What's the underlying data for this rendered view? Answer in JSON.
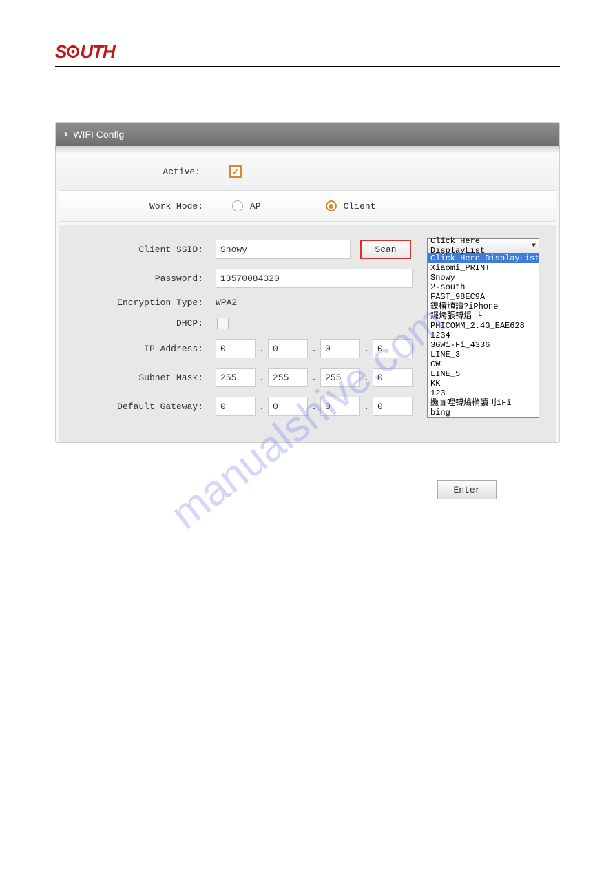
{
  "logo": {
    "s": "S",
    "u": "U",
    "t": "T",
    "h": "H"
  },
  "panel_title": "WIFI Config",
  "labels": {
    "active": "Active:",
    "work_mode": "Work Mode:",
    "client_ssid": "Client_SSID:",
    "password": "Password:",
    "encryption": "Encryption Type:",
    "dhcp": "DHCP:",
    "ip": "IP Address:",
    "subnet": "Subnet Mask:",
    "gateway": "Default Gateway:"
  },
  "work_mode": {
    "ap": "AP",
    "client": "Client"
  },
  "values": {
    "ssid": "Snowy",
    "password": "13570084320",
    "encryption": "WPA2",
    "ip": [
      "0",
      "0",
      "0",
      "0"
    ],
    "subnet": [
      "255",
      "255",
      "255",
      "0"
    ],
    "gateway": [
      "0",
      "0",
      "0",
      "0"
    ]
  },
  "buttons": {
    "scan": "Scan",
    "enter": "Enter"
  },
  "dropdown": {
    "selected": "Click Here DisplayList",
    "items": [
      "Click Here DisplayList",
      "Xiaomi_PRINT",
      "Snowy",
      "2-south",
      "FAST_98EC9A",
      "鎳椿頒讀?iPhone",
      "鑼烤張镈熖 └",
      "PHICOMM_2.4G_EAE628",
      "1234",
      "3GWi-Fi_4336",
      "LINE_3",
      "CW",
      "LINE_5",
      "KK",
      "123",
      "嫐ョ哩镈熻樇讀刂iFi",
      "bing"
    ]
  },
  "watermark": "manualshive.com"
}
